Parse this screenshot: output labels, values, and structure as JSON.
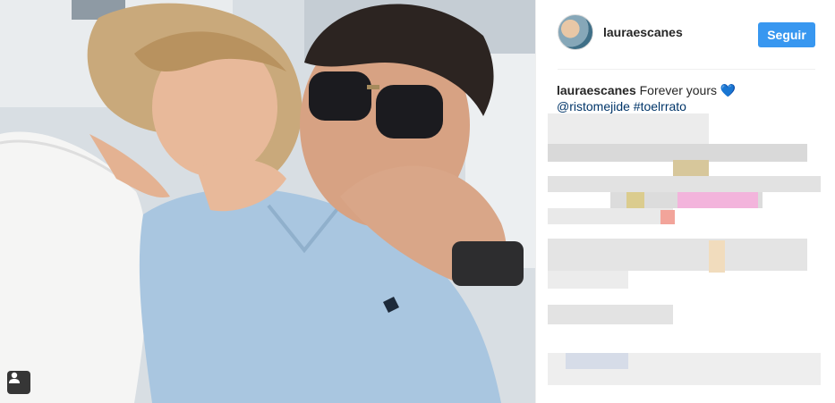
{
  "post": {
    "username": "lauraescanes",
    "follow_label": "Seguir",
    "caption": {
      "user": "lauraescanes",
      "text": "Forever yours",
      "emoji": "💙",
      "mention": "@ristomejide",
      "hashtag": "#toelrrato"
    }
  },
  "icons": {
    "tag": "person-tag-icon",
    "avatar": "profile-avatar"
  },
  "colors": {
    "follow_button": "#3897f0",
    "link": "#003569",
    "heart": "#1e7be6"
  }
}
